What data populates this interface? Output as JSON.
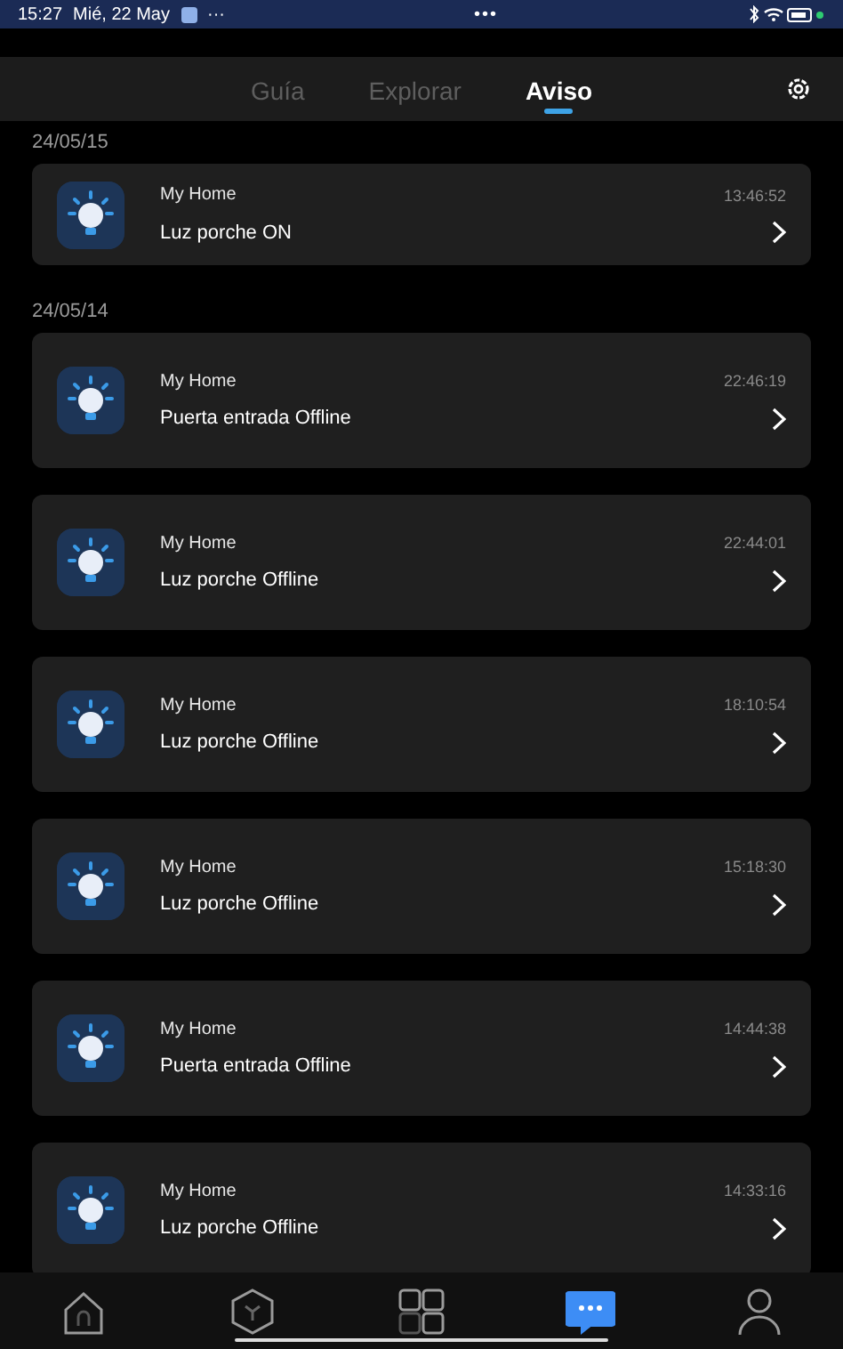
{
  "status_bar": {
    "time": "15:27",
    "date": "Mié, 22 May",
    "more": "···",
    "center_dots": "•••"
  },
  "tabs": [
    {
      "label": "Guía",
      "selected": false
    },
    {
      "label": "Explorar",
      "selected": false
    },
    {
      "label": "Aviso",
      "selected": true
    }
  ],
  "groups": [
    {
      "date": "24/05/15",
      "notifications": [
        {
          "home": "My Home",
          "time": "13:46:52",
          "message": "Luz porche ON"
        }
      ]
    },
    {
      "date": "24/05/14",
      "notifications": [
        {
          "home": "My Home",
          "time": "22:46:19",
          "message": "Puerta entrada Offline"
        },
        {
          "home": "My Home",
          "time": "22:44:01",
          "message": "Luz porche Offline"
        },
        {
          "home": "My Home",
          "time": "18:10:54",
          "message": "Luz porche Offline"
        },
        {
          "home": "My Home",
          "time": "15:18:30",
          "message": "Luz porche Offline"
        },
        {
          "home": "My Home",
          "time": "14:44:38",
          "message": "Puerta entrada Offline"
        },
        {
          "home": "My Home",
          "time": "14:33:16",
          "message": "Luz porche Offline"
        }
      ]
    }
  ],
  "nav": [
    {
      "kind": "home",
      "selected": false
    },
    {
      "kind": "scene",
      "selected": false
    },
    {
      "kind": "devices",
      "selected": false
    },
    {
      "kind": "messages",
      "selected": true
    },
    {
      "kind": "profile",
      "selected": false
    }
  ]
}
